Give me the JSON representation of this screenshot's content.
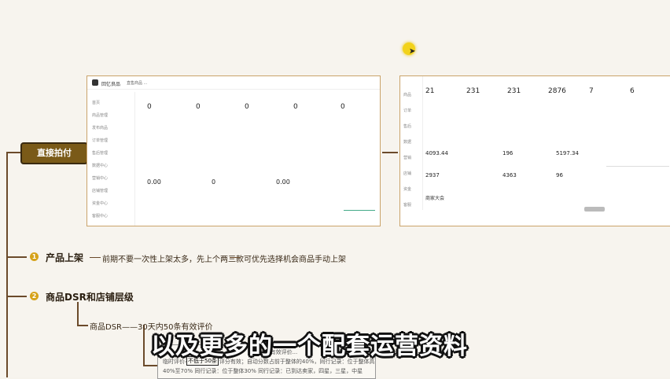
{
  "mindmap": {
    "root_node": "直接拍付",
    "branch1": {
      "number": "1",
      "label": "产品上架",
      "items": [
        "前期不要一次性上架太多，先上个两三款",
        "可优先选择机会商品手动上架"
      ]
    },
    "branch2": {
      "number": "2",
      "label": "商品DSR和店铺层级",
      "child": "商品DSR——30天内50条有效评价"
    },
    "doc_lines": [
      "...30天有效评价...",
      "临时评价不低于50条；评分有效；自动分数占前于整体的40%，同行记录：位于整体高",
      "40%至70%  同行记录：位于整体30%  同行记录：已到达卖家，四星，三星，中星"
    ],
    "highlight": "不低于50条"
  },
  "left_screen": {
    "shop_name": "回忆良品",
    "header_meta": "直售商品  ...",
    "stats_row1": [
      "0",
      "0",
      "0",
      "0",
      "0"
    ],
    "stats_row2_values": [
      "0.00",
      "0",
      "0.00"
    ],
    "sidebar_items": [
      "首页",
      "商品管理",
      "发布商品",
      "订单管理",
      "售后管理",
      "数据中心",
      "营销中心",
      "店铺管理",
      "资金中心",
      "客服中心"
    ]
  },
  "right_screen": {
    "stats_row1": [
      "21",
      "231",
      "231",
      "2876",
      "7",
      "6"
    ],
    "stats_row2": [
      "4093.44",
      "196",
      "5197.34"
    ],
    "stats_row3": [
      "2937",
      "4363",
      "96"
    ],
    "sidebar_items": [
      "商品",
      "订单",
      "售后",
      "数据",
      "营销",
      "店铺",
      "资金",
      "客服"
    ],
    "banner_title": "商家大会"
  },
  "subtitle": "以及更多的一个配套运营资料",
  "colors": {
    "accent": "#7a5a18",
    "line": "#6b4a2a",
    "dot": "#d6a21a"
  }
}
